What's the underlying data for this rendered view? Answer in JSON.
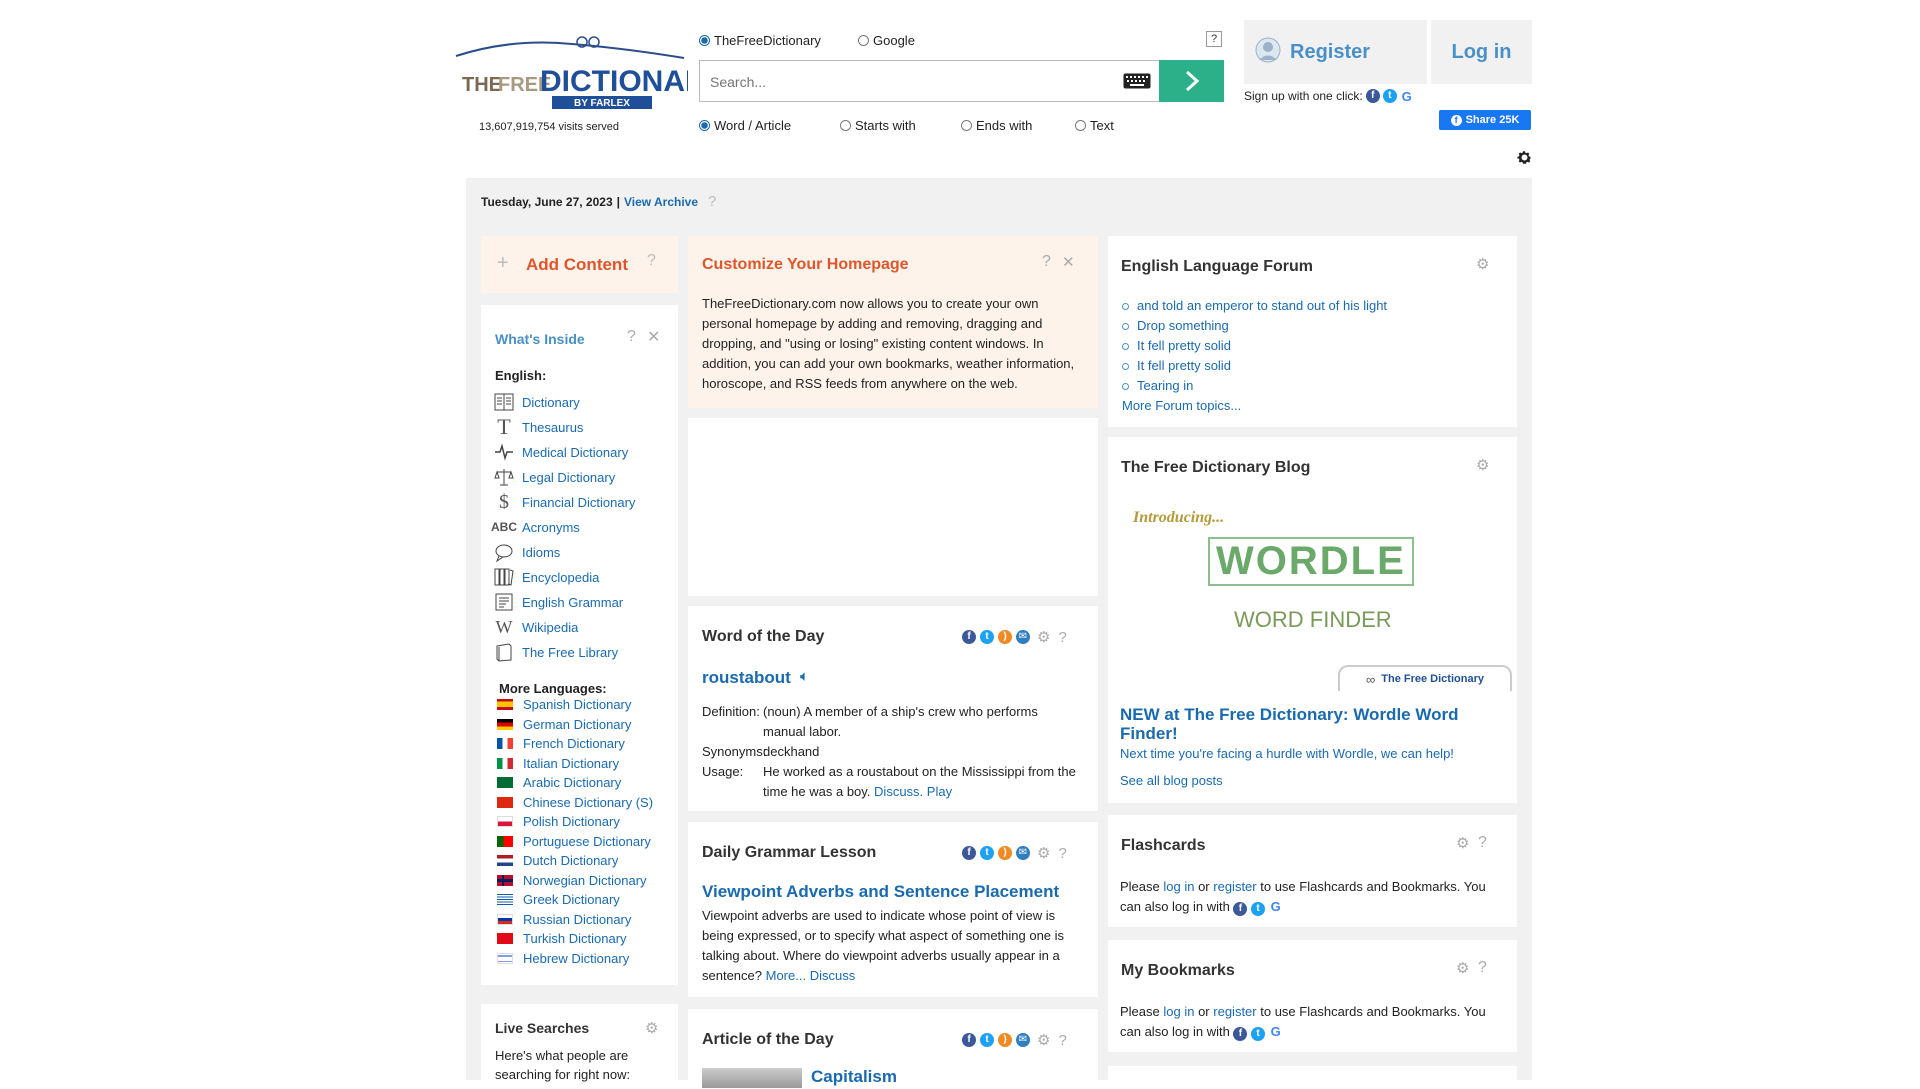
{
  "header": {
    "logo_text": "THEFREEDICTIONARY",
    "logo_sub": "BY FARLEX",
    "visits": "13,607,919,754 visits served",
    "source_options": [
      "TheFreeDictionary",
      "Google"
    ],
    "help": "?",
    "search_placeholder": "Search...",
    "mode_options": [
      "Word / Article",
      "Starts with",
      "Ends with",
      "Text"
    ],
    "register": "Register",
    "login": "Log in",
    "signup": "Sign up with one click:",
    "share": "Share 25K"
  },
  "datebar": {
    "date": "Tuesday, June 27, 2023",
    "sep": "|",
    "archive": "View Archive",
    "help": "?"
  },
  "add_content": {
    "plus": "+",
    "label": "Add Content",
    "help": "?"
  },
  "whats_inside": {
    "title": "What's Inside",
    "english_heading": "English:",
    "english_items": [
      {
        "icon": "book-icon",
        "label": "Dictionary"
      },
      {
        "icon": "thesaurus-icon",
        "label": "Thesaurus"
      },
      {
        "icon": "heartbeat-icon",
        "label": "Medical Dictionary"
      },
      {
        "icon": "scales-icon",
        "label": "Legal Dictionary"
      },
      {
        "icon": "dollar-icon",
        "label": "Financial Dictionary"
      },
      {
        "icon": "abc-icon",
        "label": "Acronyms"
      },
      {
        "icon": "speech-icon",
        "label": "Idioms"
      },
      {
        "icon": "books-icon",
        "label": "Encyclopedia"
      },
      {
        "icon": "grammar-icon",
        "label": "English Grammar"
      },
      {
        "icon": "wikipedia-icon",
        "label": "Wikipedia"
      },
      {
        "icon": "library-icon",
        "label": "The Free Library"
      }
    ],
    "languages_heading": "More Languages:",
    "languages": [
      {
        "flag": "es",
        "label": "Spanish Dictionary"
      },
      {
        "flag": "de",
        "label": "German Dictionary"
      },
      {
        "flag": "fr",
        "label": "French Dictionary"
      },
      {
        "flag": "it",
        "label": "Italian Dictionary"
      },
      {
        "flag": "sa",
        "label": "Arabic Dictionary"
      },
      {
        "flag": "cn",
        "label": "Chinese Dictionary (S)"
      },
      {
        "flag": "pl",
        "label": "Polish Dictionary"
      },
      {
        "flag": "pt",
        "label": "Portuguese Dictionary"
      },
      {
        "flag": "nl",
        "label": "Dutch Dictionary"
      },
      {
        "flag": "no",
        "label": "Norwegian Dictionary"
      },
      {
        "flag": "gr",
        "label": "Greek Dictionary"
      },
      {
        "flag": "ru",
        "label": "Russian Dictionary"
      },
      {
        "flag": "tr",
        "label": "Turkish Dictionary"
      },
      {
        "flag": "il",
        "label": "Hebrew Dictionary"
      }
    ]
  },
  "live_searches": {
    "title": "Live Searches",
    "text": "Here's what people are searching for right now:"
  },
  "customize": {
    "title": "Customize Your Homepage",
    "body": "TheFreeDictionary.com now allows you to create your own personal homepage by adding and removing, dragging and dropping, and \"using or losing\" existing content windows. In addition, you can add your own bookmarks, weather information, horoscope, and RSS feeds from anywhere on the web."
  },
  "wotd": {
    "title": "Word of the Day",
    "word": "roustabout",
    "definition_label": "Definition:",
    "definition": "(noun) A member of a ship's crew who performs manual labor.",
    "synonyms_label": "Synonyms:",
    "synonyms": "deckhand",
    "usage_label": "Usage:",
    "usage": "He worked as a roustabout on the Mississippi from the time he was a boy.",
    "discuss": "Discuss.",
    "play": "Play"
  },
  "grammar": {
    "title": "Daily Grammar Lesson",
    "headline": "Viewpoint Adverbs and Sentence Placement",
    "body": "Viewpoint adverbs are used to indicate whose point of view is being expressed, or to specify what aspect of something one is talking about. Where do viewpoint adverbs usually appear in a sentence?",
    "more": "More...",
    "discuss": "Discuss"
  },
  "article": {
    "title": "Article of the Day",
    "headline": "Capitalism"
  },
  "forum": {
    "title": "English Language Forum",
    "topics": [
      "and told an emperor to stand out of his light",
      "Drop something",
      "It fell pretty solid",
      "It fell pretty solid",
      "Tearing in"
    ],
    "more": "More Forum topics..."
  },
  "blog": {
    "title": "The Free Dictionary Blog",
    "img_intro": "Introducing...",
    "img_word": "WORDLE",
    "img_sub": "WORD FINDER",
    "img_tab": "The Free Dictionary",
    "headline": "NEW at The Free Dictionary: Wordle Word Finder!",
    "summary": "Next time you're facing a hurdle with Wordle, we can help!",
    "all_posts": "See all blog posts"
  },
  "flashcards": {
    "title": "Flashcards",
    "please": "Please",
    "login": "log in",
    "or": "or",
    "register": "register",
    "rest": "to use Flashcards and Bookmarks. You can also log in with"
  },
  "bookmarks": {
    "title": "My Bookmarks",
    "please": "Please",
    "login": "log in",
    "or": "or",
    "register": "register",
    "rest": "to use Flashcards and Bookmarks. You can also log in with"
  },
  "colors": {
    "accent_orange": "#e0562c",
    "link_blue": "#1a6ab0",
    "search_green": "#2bb08a",
    "panel_gray": "#f1f1f1",
    "tinted_box": "#fdf3ea"
  }
}
